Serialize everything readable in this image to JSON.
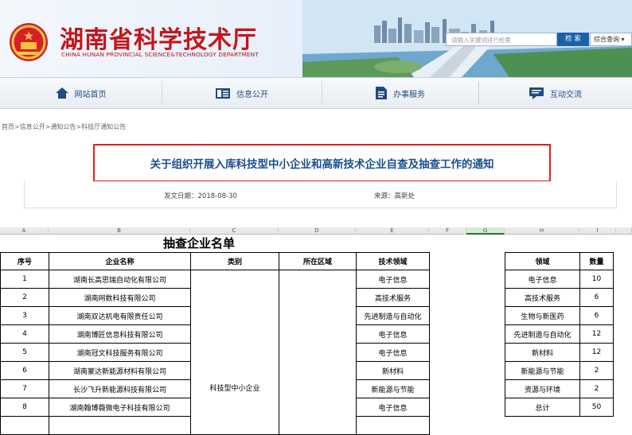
{
  "header": {
    "title": "湖南省科学技术厅",
    "subtitle": "CHINA HUNAN PROVINCIAL SCIENCE&TECHNOLOGY DEPARTMENT",
    "search_placeholder": "请输入关键词进行检索",
    "search_button": "检 索",
    "search_scope": "综合查询"
  },
  "nav": {
    "items": [
      {
        "label": "网站首页",
        "icon": "home-icon"
      },
      {
        "label": "信息公开",
        "icon": "info-icon"
      },
      {
        "label": "办事服务",
        "icon": "document-icon"
      },
      {
        "label": "互动交流",
        "icon": "chat-icon"
      }
    ]
  },
  "breadcrumb": "首页>信息公开>通知公告>科技厅通知公告",
  "article": {
    "title": "关于组织开展入库科技型中小企业和高新技术企业自查及抽查工作的通知",
    "date": "发文日期：2018-08-30",
    "source": "来源：高新处"
  },
  "sheet": {
    "columns": [
      "A",
      "B",
      "C",
      "D",
      "E",
      "F",
      "G",
      "H",
      "I"
    ],
    "selected_column": "G",
    "title": "抽查企业名单",
    "headers": [
      "序号",
      "企业名称",
      "类别",
      "所在区域",
      "技术领域"
    ],
    "category_merged": "科技型中小企业",
    "rows": [
      [
        "1",
        "湖南长高思瑞自动化有限公司",
        "电子信息"
      ],
      [
        "2",
        "湖南网数科技有限公司",
        "高技术服务"
      ],
      [
        "3",
        "湖南双达机电有限责任公司",
        "先进制造与自动化"
      ],
      [
        "4",
        "湖南博匠信息科技有限公司",
        "电子信息"
      ],
      [
        "5",
        "湖南冠文科技服务有限公司",
        "电子信息"
      ],
      [
        "6",
        "湖南蒙达新能源材料有限公司",
        "新材料"
      ],
      [
        "7",
        "长沙飞升新能源科技有限公司",
        "新能源与节能"
      ],
      [
        "8",
        "湖南翰博薇微电子科技有限公司",
        "电子信息"
      ]
    ],
    "summary_headers": [
      "领域",
      "数量"
    ],
    "summary_rows": [
      [
        "电子信息",
        "10"
      ],
      [
        "高技术服务",
        "6"
      ],
      [
        "生物与新医药",
        "6"
      ],
      [
        "先进制造与自动化",
        "12"
      ],
      [
        "新材料",
        "12"
      ],
      [
        "新能源与节能",
        "2"
      ],
      [
        "资源与环境",
        "2"
      ],
      [
        "总计",
        "50"
      ]
    ]
  }
}
